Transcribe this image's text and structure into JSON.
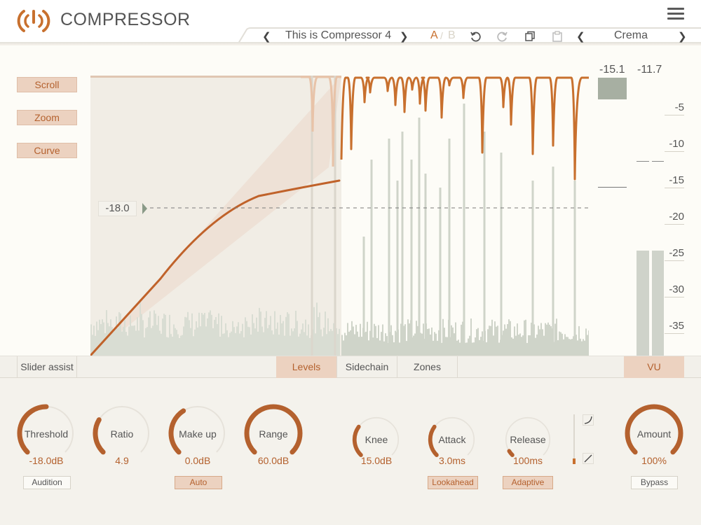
{
  "header": {
    "title": "COMPRESSOR",
    "preset_name": "This is Compressor 4",
    "ab_a": "A",
    "ab_sep": "/",
    "ab_b": "B",
    "theme_name": "Crema"
  },
  "display": {
    "side_buttons": [
      "Scroll",
      "Zoom",
      "Curve"
    ],
    "threshold_label": "-18.0",
    "meter_values": [
      "-15.1",
      "-11.7"
    ],
    "scale_labels": [
      "-5",
      "-10",
      "-15",
      "-20",
      "-25",
      "-30",
      "-35"
    ]
  },
  "tabs": {
    "slider_assist": "Slider assist",
    "levels": "Levels",
    "sidechain": "Sidechain",
    "zones": "Zones",
    "vu": "VU"
  },
  "knobs": [
    {
      "name": "Threshold",
      "value": "-18.0dB",
      "level": 0.5,
      "button": "Audition",
      "button_on": false
    },
    {
      "name": "Ratio",
      "value": "4.9",
      "level": 0.28,
      "button": "",
      "button_on": false
    },
    {
      "name": "Make up",
      "value": "0.0dB",
      "level": 0.38,
      "button": "Auto",
      "button_on": true
    },
    {
      "name": "Range",
      "value": "60.0dB",
      "level": 1.0,
      "button": "",
      "button_on": false
    },
    {
      "name": "Knee",
      "value": "15.0dB",
      "level": 0.3,
      "button": "",
      "button_on": false
    },
    {
      "name": "Attack",
      "value": "3.0ms",
      "level": 0.3,
      "button": "Lookahead",
      "button_on": true
    },
    {
      "name": "Release",
      "value": "100ms",
      "level": 0.05,
      "button": "Adaptive",
      "button_on": true
    },
    {
      "name": "Amount",
      "value": "100%",
      "level": 1.0,
      "button": "Bypass",
      "button_on": false
    }
  ],
  "colors": {
    "accent": "#c8702e",
    "accent_dark": "#b4612e",
    "button_active_bg": "#ecd2c0",
    "meter_gray": "#a7afa2",
    "waveform_gray": "#d7dcd2"
  }
}
